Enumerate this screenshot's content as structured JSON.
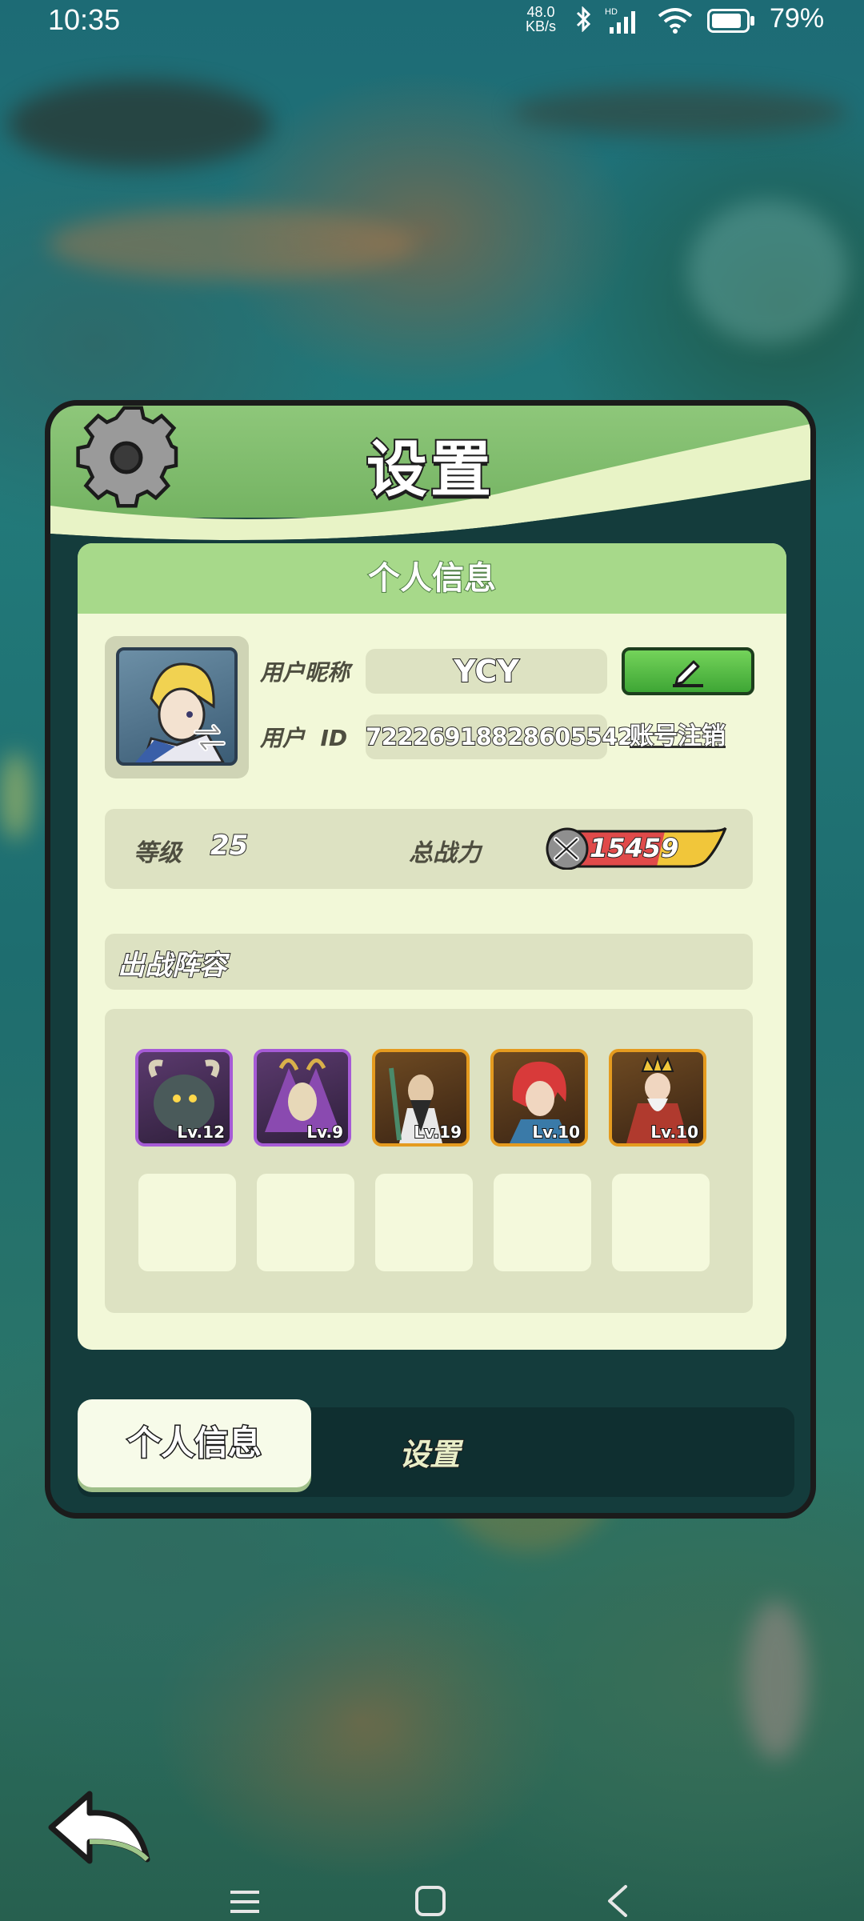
{
  "status_bar": {
    "time": "10:35",
    "net_speed_value": "48.0",
    "net_speed_unit": "KB/s",
    "signal_label": "HD",
    "battery": "79%"
  },
  "dialog": {
    "title": "设置",
    "section_title": "个人信息",
    "profile": {
      "nickname_label": "用户昵称",
      "nickname": "YCY",
      "id_label": "用户  ID",
      "user_id": "72226918828605542",
      "cancel_account": "账号注销"
    },
    "stats": {
      "level_label": "等级",
      "level": "25",
      "power_label": "总战力",
      "power": "15459"
    },
    "lineup": {
      "title": "出战阵容",
      "heroes": [
        {
          "level": "Lv.12",
          "rarity": "epic"
        },
        {
          "level": "Lv.9",
          "rarity": "epic"
        },
        {
          "level": "Lv.19",
          "rarity": "legend"
        },
        {
          "level": "Lv.10",
          "rarity": "legend"
        },
        {
          "level": "Lv.10",
          "rarity": "legend"
        }
      ],
      "empty_slots": 5
    },
    "tabs": [
      {
        "label": "个人信息",
        "active": true
      },
      {
        "label": "设置",
        "active": false
      }
    ]
  },
  "colors": {
    "header_green": "#8ec77a",
    "panel_bg": "#f2f8d8",
    "field_bg": "#dde2c2",
    "epic_border": "#a65bd6",
    "legend_border": "#e59b1f",
    "edit_button": "#4fbf3f"
  },
  "icons": [
    "gear-icon",
    "swap-icon",
    "edit-pencil-icon",
    "power-swords-icon",
    "back-arrow-icon",
    "bluetooth-icon",
    "wifi-icon",
    "battery-icon"
  ]
}
